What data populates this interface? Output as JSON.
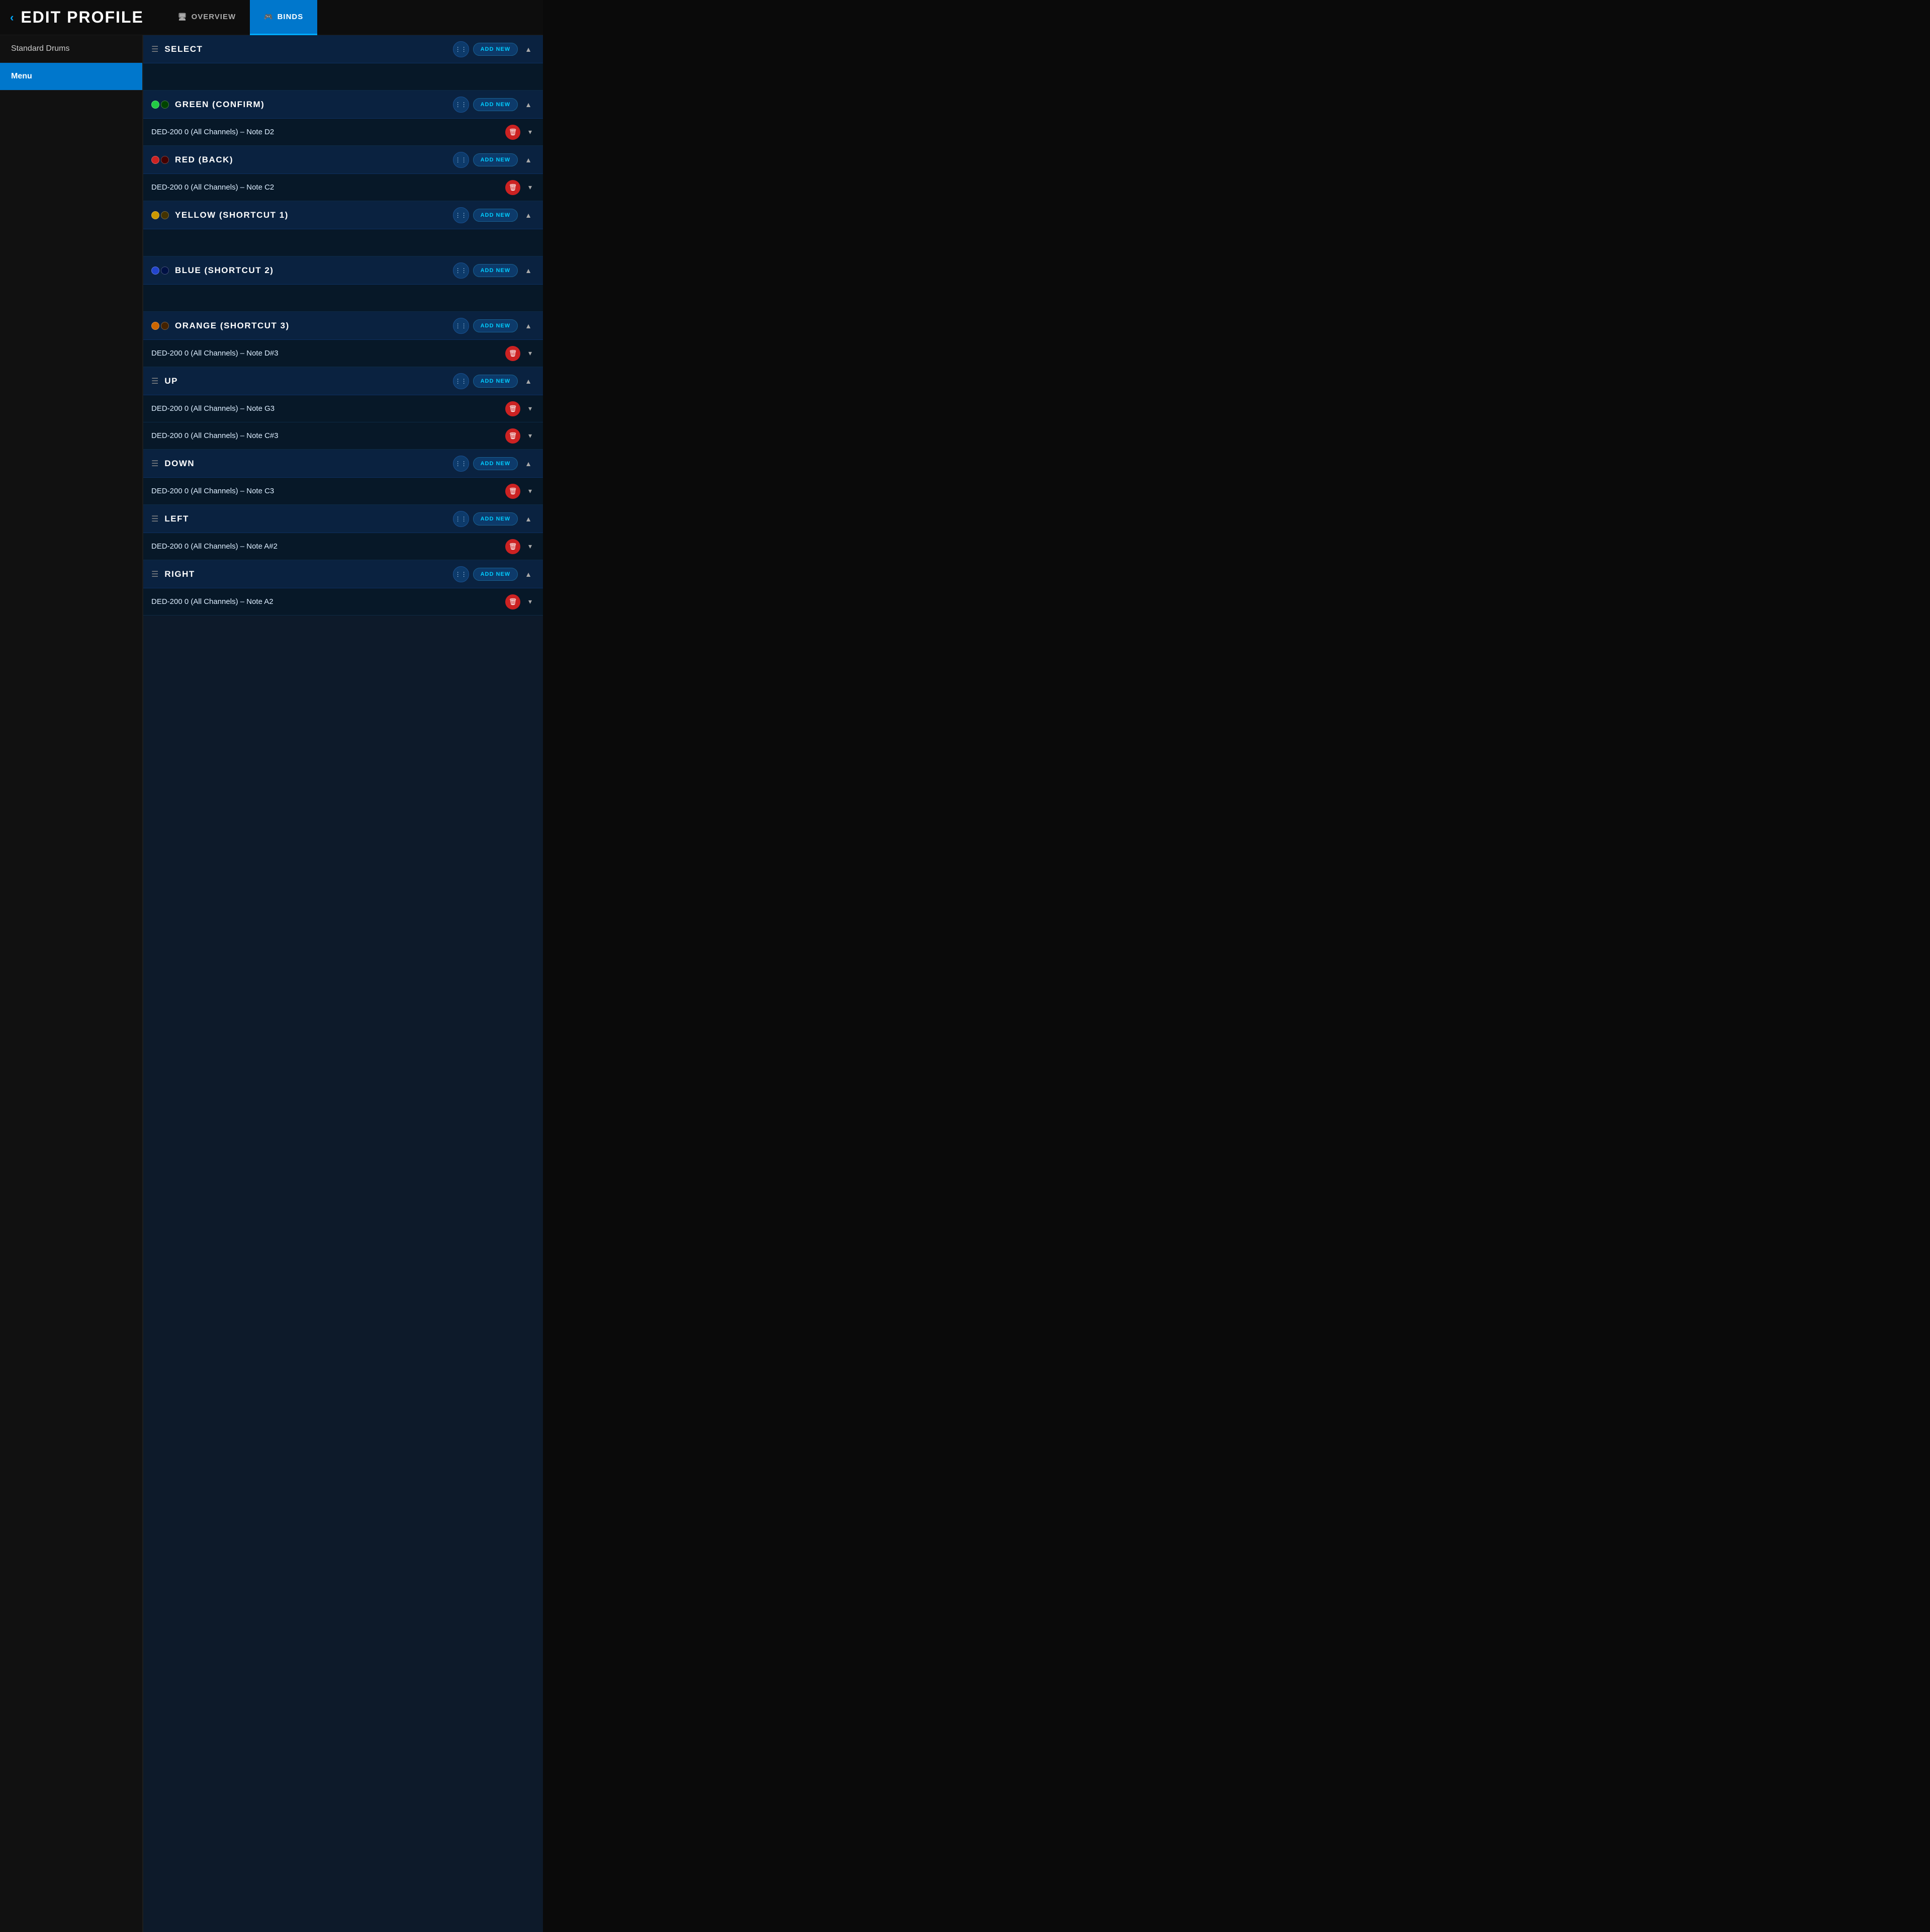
{
  "header": {
    "back_label": "‹",
    "title": "EDIT PROFILE",
    "tabs": [
      {
        "id": "overview",
        "label": "OVERVIEW",
        "icon": "🖥",
        "active": false
      },
      {
        "id": "binds",
        "label": "BINDS",
        "icon": "🎮",
        "active": true
      }
    ]
  },
  "sidebar": {
    "items": [
      {
        "id": "standard-drums",
        "label": "Standard Drums",
        "active": false
      },
      {
        "id": "menu",
        "label": "Menu",
        "active": true
      }
    ]
  },
  "sections": [
    {
      "id": "select",
      "title": "SELECT",
      "has_toggle": false,
      "toggle_colors": [],
      "add_new_label": "ADD NEW",
      "collapsed": false,
      "binds": []
    },
    {
      "id": "green-confirm",
      "title": "GREEN (CONFIRM)",
      "has_toggle": true,
      "toggle_colors": [
        "#22cc44",
        "#004400"
      ],
      "add_new_label": "ADD NEW",
      "collapsed": false,
      "binds": [
        {
          "label": "DED-200 0 (All Channels) – Note D2"
        }
      ]
    },
    {
      "id": "red-back",
      "title": "RED (BACK)",
      "has_toggle": true,
      "toggle_colors": [
        "#cc2222",
        "#440000"
      ],
      "add_new_label": "ADD NEW",
      "collapsed": false,
      "binds": [
        {
          "label": "DED-200 0 (All Channels) – Note C2"
        }
      ]
    },
    {
      "id": "yellow-shortcut1",
      "title": "YELLOW (SHORTCUT 1)",
      "has_toggle": true,
      "toggle_colors": [
        "#cc9900",
        "#443300"
      ],
      "add_new_label": "ADD NEW",
      "collapsed": false,
      "binds": []
    },
    {
      "id": "blue-shortcut2",
      "title": "BLUE (SHORTCUT 2)",
      "has_toggle": true,
      "toggle_colors": [
        "#2244cc",
        "#001144"
      ],
      "add_new_label": "ADD NEW",
      "collapsed": false,
      "binds": []
    },
    {
      "id": "orange-shortcut3",
      "title": "ORANGE (SHORTCUT 3)",
      "has_toggle": true,
      "toggle_colors": [
        "#cc6600",
        "#442200"
      ],
      "add_new_label": "ADD NEW",
      "collapsed": false,
      "binds": [
        {
          "label": "DED-200 0 (All Channels) – Note D#3"
        }
      ]
    },
    {
      "id": "up",
      "title": "UP",
      "has_toggle": false,
      "toggle_colors": [],
      "add_new_label": "ADD NEW",
      "collapsed": false,
      "binds": [
        {
          "label": "DED-200 0 (All Channels) – Note G3"
        },
        {
          "label": "DED-200 0 (All Channels) – Note C#3"
        }
      ]
    },
    {
      "id": "down",
      "title": "DOWN",
      "has_toggle": false,
      "toggle_colors": [],
      "add_new_label": "ADD NEW",
      "collapsed": false,
      "binds": [
        {
          "label": "DED-200 0 (All Channels) – Note C3"
        }
      ]
    },
    {
      "id": "left",
      "title": "LEFT",
      "has_toggle": false,
      "toggle_colors": [],
      "add_new_label": "ADD NEW",
      "collapsed": false,
      "binds": [
        {
          "label": "DED-200 0 (All Channels) – Note A#2"
        }
      ]
    },
    {
      "id": "right",
      "title": "RIGHT",
      "has_toggle": false,
      "toggle_colors": [],
      "add_new_label": "ADD NEW",
      "collapsed": false,
      "binds": [
        {
          "label": "DED-200 0 (All Channels) – Note A2"
        }
      ]
    }
  ]
}
